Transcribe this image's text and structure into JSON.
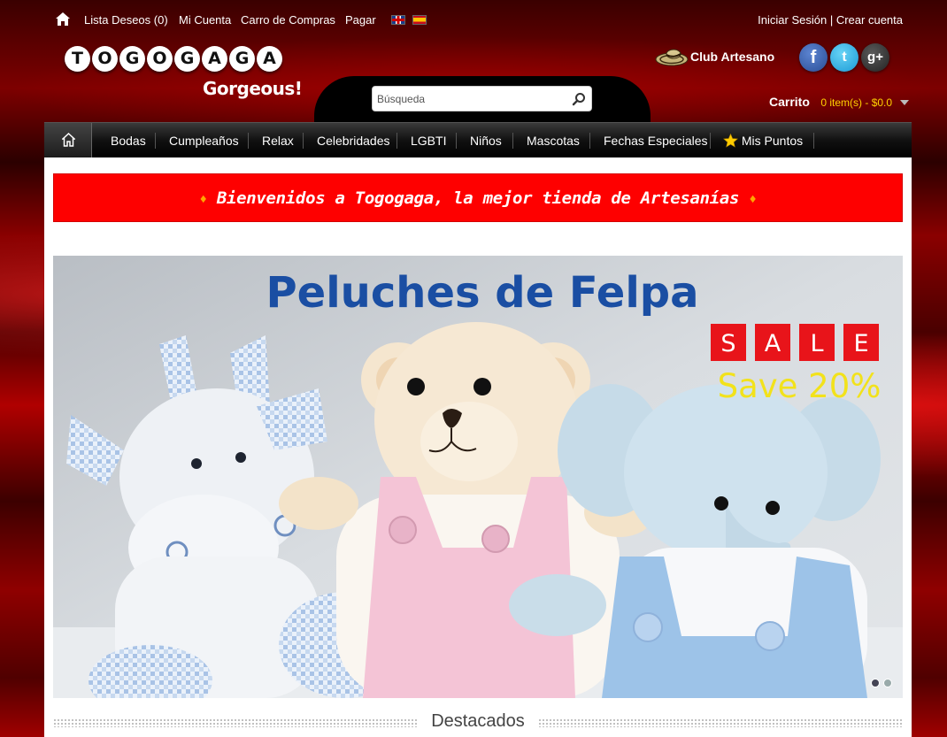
{
  "topbar": {
    "links": [
      "Lista Deseos (0)",
      "Mi Cuenta",
      "Carro de Compras",
      "Pagar"
    ],
    "login": "Iniciar Sesión",
    "separator": "|",
    "register": "Crear cuenta"
  },
  "logo": {
    "letters": [
      "T",
      "O",
      "G",
      "O",
      "G",
      "A",
      "G",
      "A"
    ],
    "tagline": "Gorgeous!"
  },
  "search": {
    "placeholder": "Búsqueda"
  },
  "club": {
    "label": "Club Artesano"
  },
  "social": {
    "facebook": "f",
    "twitter": "t",
    "googleplus": "g+"
  },
  "cart": {
    "label": "Carrito",
    "summary": "0 item(s) - $0.0"
  },
  "nav": {
    "items": [
      "Bodas",
      "Cumpleaños",
      "Relax",
      "Celebridades",
      "LGBTI",
      "Niños",
      "Mascotas",
      "Fechas Especiales"
    ],
    "points": "Mis Puntos"
  },
  "banner": {
    "welcome": "Bienvenidos a Togogaga, la mejor tienda de Artesanías",
    "diamond": "♦"
  },
  "slide": {
    "title": "Peluches de Felpa",
    "sale_letters": [
      "S",
      "A",
      "L",
      "E"
    ],
    "save": "Save 20%",
    "dots": 2,
    "active_dot": 1
  },
  "featured": {
    "title": "Destacados"
  },
  "colors": {
    "welcome_bg": "#fe0000",
    "cart_summary": "#ffd200",
    "slide_title": "#1a4ea3",
    "sale_box": "#e8141a",
    "save_text": "#f2e21b"
  }
}
